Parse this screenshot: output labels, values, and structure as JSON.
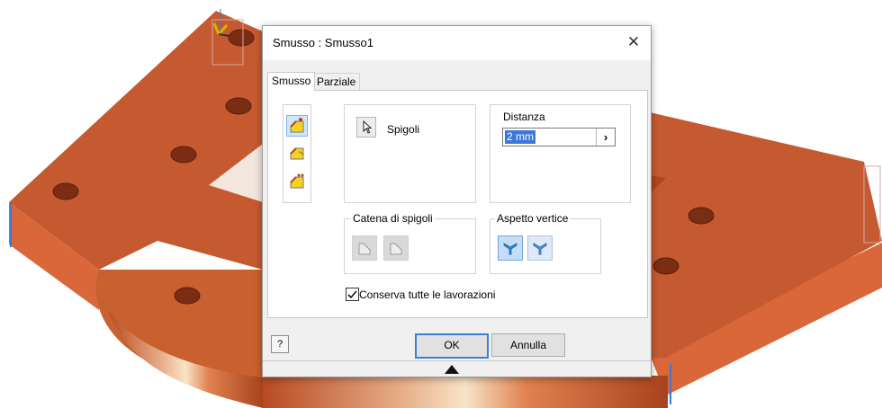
{
  "dialog": {
    "title": "Smusso : Smusso1",
    "close_glyph": "✕",
    "tabs": [
      {
        "label": "Smusso",
        "active": true
      },
      {
        "label": "Parziale",
        "active": false
      }
    ],
    "chamfer_modes": [
      {
        "icon": "distance-chamfer-icon",
        "selected": true
      },
      {
        "icon": "distance-angle-chamfer-icon",
        "selected": false
      },
      {
        "icon": "two-distances-chamfer-icon",
        "selected": false
      }
    ],
    "edges_label": "Spigoli",
    "distance": {
      "label": "Distanza",
      "value": "2 mm",
      "arrow": "›"
    },
    "edge_chain": {
      "label": "Catena di spigoli"
    },
    "corner_setback": {
      "label": "Aspetto vertice"
    },
    "preserve_all": {
      "label": "Conserva tutte le lavorazioni",
      "checked": true
    },
    "help_glyph": "?",
    "ok_label": "OK",
    "cancel_label": "Annulla"
  },
  "colors": {
    "model_face": "#c2532c",
    "model_side": "#e0703f",
    "accent": "#3c7fd6",
    "icon_yellow": "#f3d224"
  }
}
